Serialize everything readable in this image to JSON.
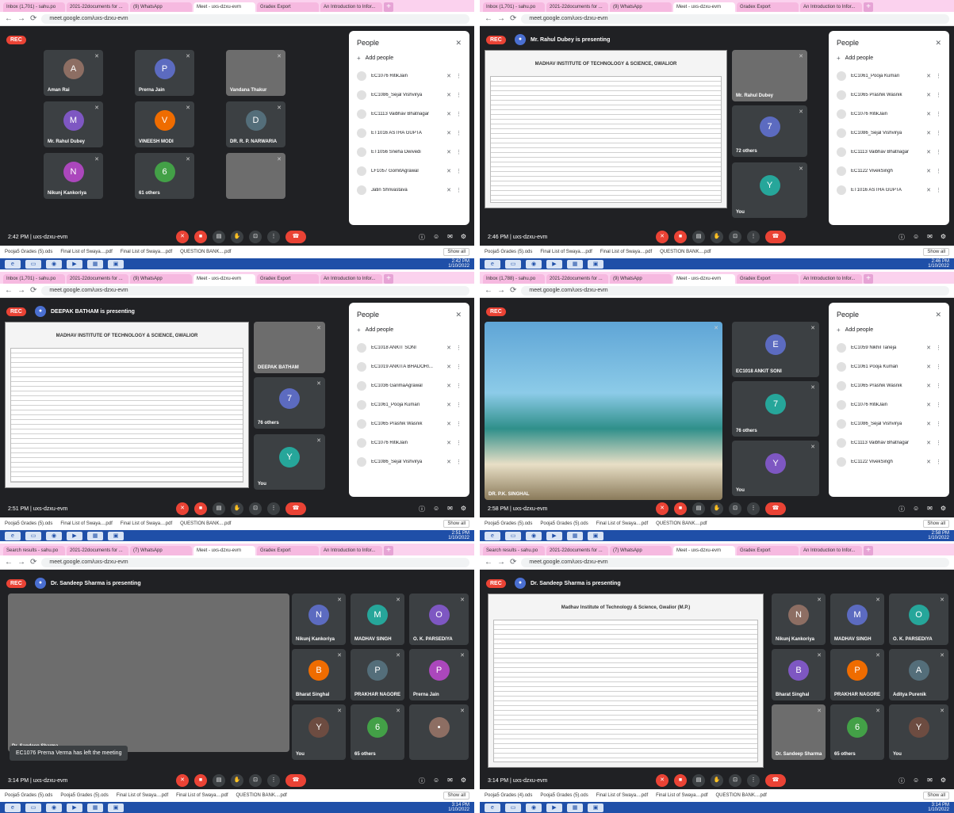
{
  "screens": [
    {
      "tabs": [
        "Inbox (1,701) - sahu.po",
        "2021-22documents for ...",
        "(9) WhatsApp",
        "Meet - uxs-dzxu-evm",
        "Gradex Export",
        "An Introduction to Infor..."
      ],
      "url": "meet.google.com/uxs-dzxu-evm",
      "rec": "REC",
      "presenter": "",
      "tiles": [
        "Aman Rai",
        "Prerna Jain",
        "Vandana Thakur",
        "Mr. Rahul Dubey",
        "VINEESH MODI",
        "DR. R. P. NARWARIA",
        "Nikunj Kankoriya",
        "61 others",
        ""
      ],
      "people_title": "People",
      "add_people": "Add people",
      "people": [
        "EC1076 RitikJain",
        "EC1086_Sejal Vishvirya",
        "EC1113 Vaibhav Bhatnagar",
        "ET1016 ASTHA GUPTA",
        "ET1056 Sneha Dwivedi",
        "LF1057 GomitAgrawal",
        "Jatin Shrivastava"
      ],
      "time": "2:42 PM | uxs-dzxu-evm",
      "downloads": [
        "Pooja5 Grades (5).ods",
        "Final List of Swaya....pdf",
        "Final List of Swaya....pdf",
        "QUESTION BANK....pdf"
      ],
      "show_all": "Show all",
      "clock": "2:42 PM",
      "date": "1/10/2022"
    },
    {
      "tabs": [
        "Inbox (1,701) - sahu.po",
        "2021-22documents for ...",
        "(9) WhatsApp",
        "Meet - uxs-dzxu-evm",
        "Gradex Export",
        "An Introduction to Infor..."
      ],
      "url": "meet.google.com/uxs-dzxu-evm",
      "rec": "REC",
      "presenter": "Mr. Rahul Dubey is presenting",
      "doc_title": "MADHAV INSTITUTE OF TECHNOLOGY & SCIENCE, GWALIOR",
      "tiles": [
        "Mr. Rahul Dubey",
        "72 others",
        "You"
      ],
      "people_title": "People",
      "add_people": "Add people",
      "people": [
        "EC1061_Pooja Kumari",
        "EC1065 Prashik Wasnik",
        "EC1076 RitikJain",
        "EC1086_Sejal Vishvirya",
        "EC1113 Vaibhav Bhatnagar",
        "EC1122 VivekSingh",
        "ET1016 ASTHA GUPTA"
      ],
      "time": "2:46 PM | uxs-dzxu-evm",
      "downloads": [
        "Pooja5 Grades (5).ods",
        "Final List of Swaya....pdf",
        "Final List of Swaya....pdf",
        "QUESTION BANK....pdf"
      ],
      "show_all": "Show all",
      "clock": "2:46 PM",
      "date": "1/10/2022"
    },
    {
      "tabs": [
        "Inbox (1,701) - sahu.po",
        "2021-22documents for ...",
        "(9) WhatsApp",
        "Meet - uxs-dzxu-evm",
        "Gradex Export",
        "An Introduction to Infor..."
      ],
      "url": "meet.google.com/uxs-dzxu-evm",
      "rec": "REC",
      "presenter": "DEEPAK BATHAM is presenting",
      "doc_title": "MADHAV INSTITUTE OF TECHNOLOGY & SCIENCE, GWALIOR",
      "tiles": [
        "DEEPAK BATHAM",
        "76 others",
        "You"
      ],
      "people_title": "People",
      "add_people": "Add people",
      "people": [
        "EC1018 ANKIT SONI",
        "EC1019 ANKITA BHADORI...",
        "EC1036 GarimaAgrawal",
        "EC1061_Pooja Kumari",
        "EC1065 Prashik Wasnik",
        "EC1076 RitikJain",
        "EC1086_Sejal Vishvirya"
      ],
      "time": "2:51 PM | uxs-dzxu-evm",
      "downloads": [
        "Pooja5 Grades (5).ods",
        "Final List of Swaya....pdf",
        "Final List of Swaya....pdf",
        "QUESTION BANK....pdf"
      ],
      "show_all": "Show all",
      "clock": "2:51 PM",
      "date": "1/10/2022"
    },
    {
      "tabs": [
        "Inbox (1,788) - sahu.po",
        "2021-22documents for ...",
        "(9) WhatsApp",
        "Meet - uxs-dzxu-evm",
        "Gradex Export",
        "An Introduction to Infor..."
      ],
      "url": "meet.google.com/uxs-dzxu-evm",
      "rec": "REC",
      "presenter": "",
      "tiles": [
        "DR. P.K. SINGHAL",
        "EC1018 ANKIT SONI",
        "76 others",
        "You"
      ],
      "people_title": "People",
      "add_people": "Add people",
      "people": [
        "EC1059 Nikhil Taneja",
        "EC1061 Pooja Kumari",
        "EC1065 Prashik Wasnik",
        "EC1076 RitikJain",
        "EC1086_Sejal Vishvirya",
        "EC1113 Vaibhav Bhatnagar",
        "EC1122 VivekSingh"
      ],
      "time": "2:58 PM | uxs-dzxu-evm",
      "downloads": [
        "Pooja5 Grades (5).ods",
        "Pooja5 Grades (5).ods",
        "Final List of Swaya....pdf",
        "QUESTION BANK....pdf"
      ],
      "show_all": "Show all",
      "clock": "2:58 PM",
      "date": "1/10/2022"
    },
    {
      "tabs": [
        "Search results - sahu.po",
        "2021-22documents for ...",
        "(7) WhatsApp",
        "Meet - uxs-dzxu-evm",
        "Gradex Export",
        "An Introduction to Infor..."
      ],
      "url": "meet.google.com/uxs-dzxu-evm",
      "rec": "REC",
      "presenter": "Dr. Sandeep Sharma is presenting",
      "tiles": [
        "Dr. Sandeep Sharma",
        "Nikunj Kankoriya",
        "MADHAV SINGH",
        "O. K. PARSEDIYA",
        "Bharat Singhal",
        "PRAKHAR NAGORE",
        "Prerna Jain",
        "65 others",
        "You"
      ],
      "toast": "EC1076 Prerna Verma has left the meeting",
      "time": "3:14 PM | uxs-dzxu-evm",
      "downloads": [
        "Pooja5 Grades (5).ods",
        "Pooja5 Grades (5).ods",
        "Final List of Swaya....pdf",
        "Final List of Swaya....pdf",
        "QUESTION BANK....pdf"
      ],
      "show_all": "Show all",
      "clock": "3:14 PM",
      "date": "1/10/2022"
    },
    {
      "tabs": [
        "Search results - sahu.po",
        "2021-22documents for ...",
        "(7) WhatsApp",
        "Meet - uxs-dzxu-evm",
        "Gradex Export",
        "An Introduction to Infor..."
      ],
      "url": "meet.google.com/uxs-dzxu-evm",
      "rec": "REC",
      "presenter": "Dr. Sandeep Sharma is presenting",
      "doc_title": "Madhav Institute of Technology & Science, Gwalior (M.P.)",
      "tiles": [
        "Nikunj Kankoriya",
        "MADHAV SINGH",
        "O. K. PARSEDIYA",
        "Bharat Singhal",
        "PRAKHAR NAGORE",
        "Aditya Purenik",
        "Dr. Sandeep Sharma",
        "65 others",
        "You"
      ],
      "time": "3:14 PM | uxs-dzxu-evm",
      "downloads": [
        "Pooja5 Grades (4).ods",
        "Pooja5 Grades (5).ods",
        "Final List of Swaya....pdf",
        "Final List of Swaya....pdf",
        "QUESTION BANK....pdf"
      ],
      "show_all": "Show all",
      "clock": "3:14 PM",
      "date": "1/10/2022"
    }
  ]
}
